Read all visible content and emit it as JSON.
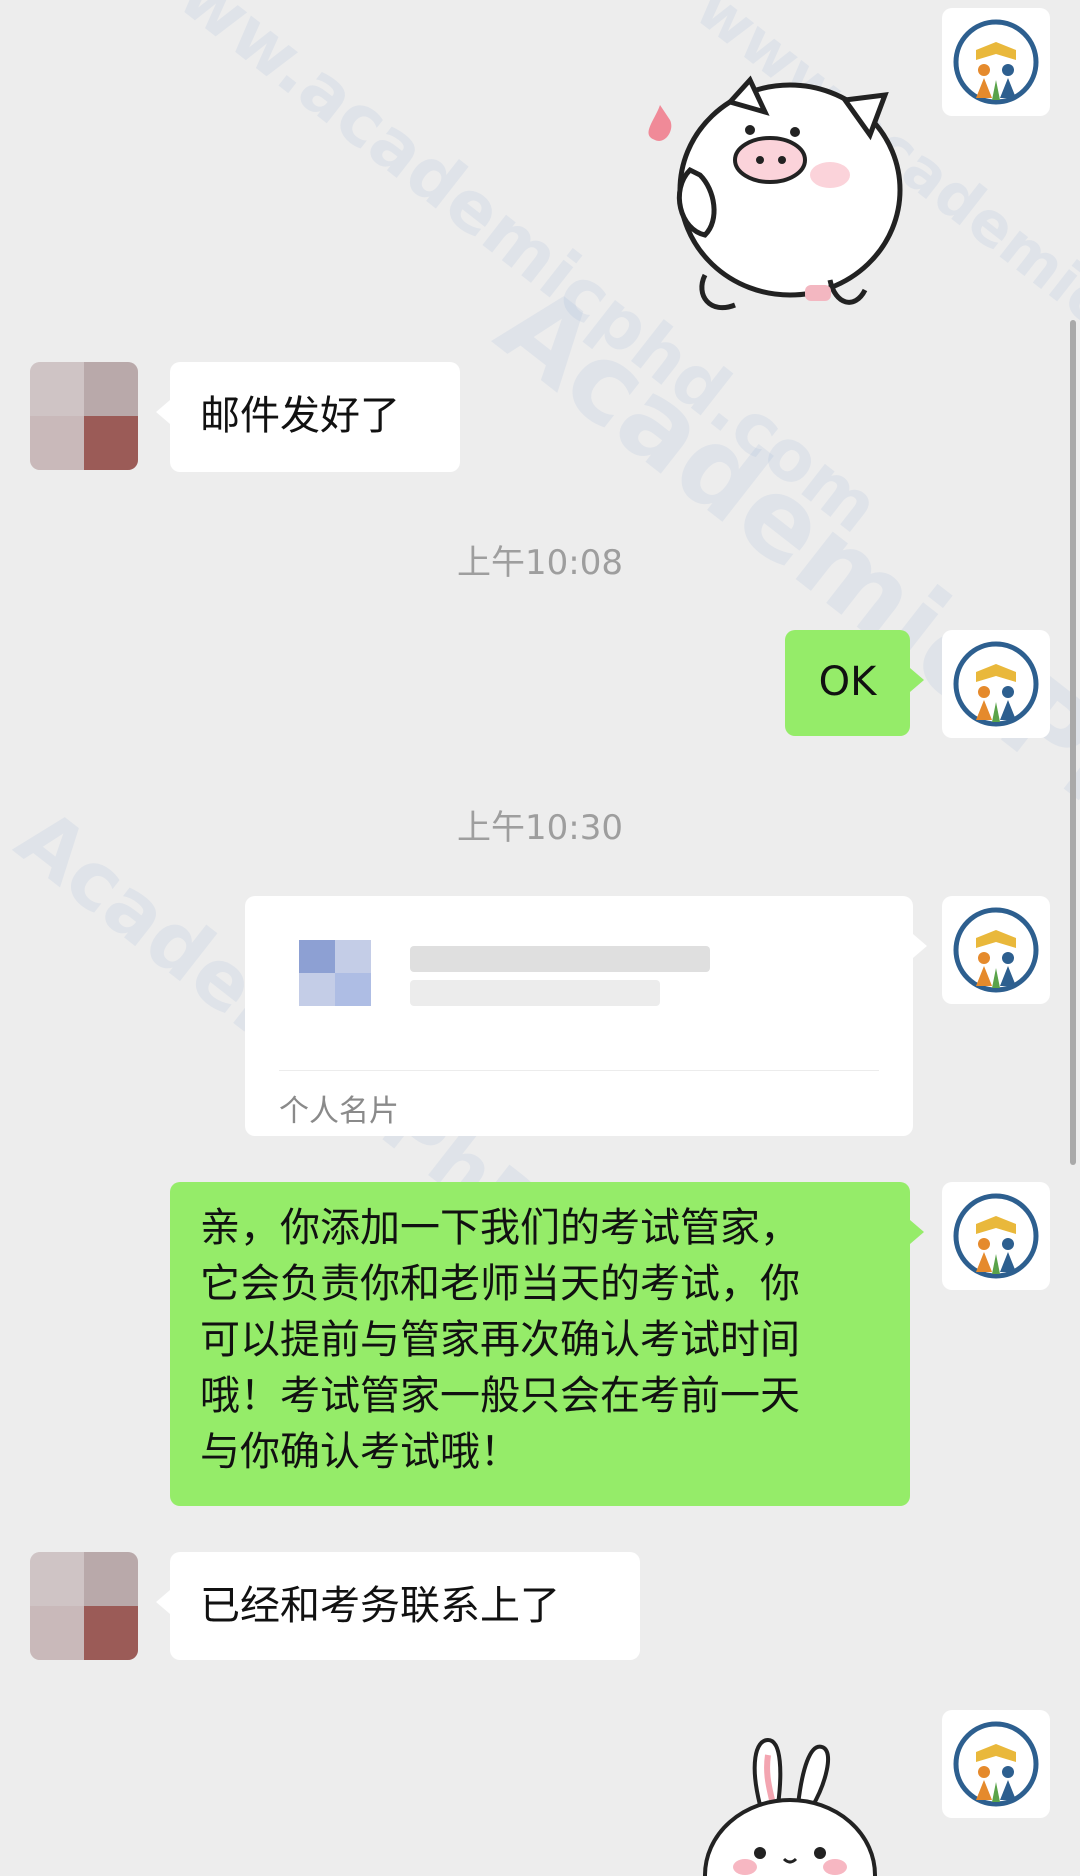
{
  "messages": {
    "m1_text": "邮件发好了",
    "time1": "上午10:08",
    "m2_text": "OK",
    "time2": "上午10:30",
    "card_label": "个人名片",
    "m3_lines": [
      "亲，你添加一下我们的考试管家，",
      "它会负责你和老师当天的考试，你",
      "可以提前与管家再次确认考试时间",
      "哦！考试管家一般只会在考前一天",
      "与你确认考试哦！"
    ],
    "m4_text": "已经和考务联系上了"
  },
  "watermark": {
    "brand": "Academic·PhD",
    "site": "www.academicphd.com"
  },
  "colors": {
    "background": "#EDEDED",
    "incoming_bubble": "#FFFFFF",
    "outgoing_bubble": "#95EC69",
    "timestamp": "#9E9E9E"
  },
  "icons": {
    "sticker_top": "pig-sticker",
    "sticker_bottom": "bunny-sticker",
    "sender_avatar": "academic-logo-icon",
    "receiver_avatar": "blurred-avatar"
  }
}
